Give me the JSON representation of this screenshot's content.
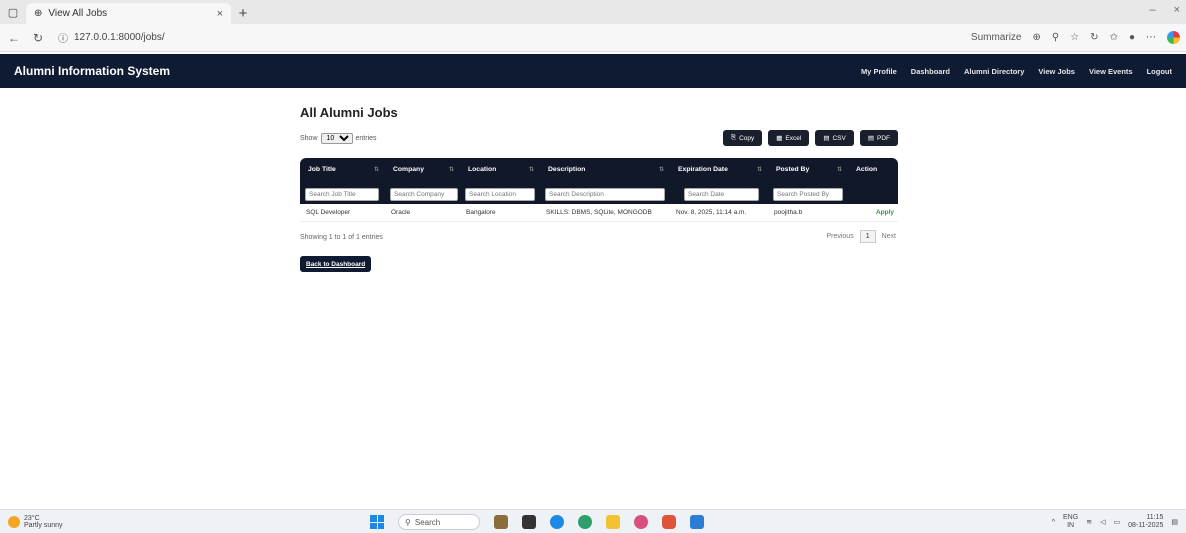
{
  "browser": {
    "tab_title": "View All Jobs",
    "tab_close": "×",
    "new_tab": "+",
    "url": "127.0.0.1:8000/jobs/",
    "summarize_label": "Summarize",
    "win_min": "–",
    "win_close": "×"
  },
  "navbar": {
    "brand": "Alumni Information System",
    "links": [
      "My Profile",
      "Dashboard",
      "Alumni Directory",
      "View Jobs",
      "View Events",
      "Logout"
    ]
  },
  "page": {
    "title": "All Alumni Jobs",
    "show_label": "Show",
    "entries_label": "entries",
    "length_value": "10"
  },
  "export_buttons": [
    "Copy",
    "Excel",
    "CSV",
    "PDF"
  ],
  "table": {
    "headers": [
      "Job Title",
      "Company",
      "Location",
      "Description",
      "Expiration Date",
      "Posted By",
      "Action"
    ],
    "filters": [
      "Search Job Title",
      "Search Company",
      "Search Location",
      "Search Description",
      "Search Date",
      "Search Posted By"
    ],
    "rows": [
      [
        "SQL Developer",
        "Oracle",
        "Bangalore",
        "SKILLS: DBMS, SQLite, MONGODB",
        "Nov. 8, 2025, 11:14 a.m.",
        "poojitha.b",
        "Apply"
      ]
    ],
    "info": "Showing 1 to 1 of 1 entries",
    "prev": "Previous",
    "page": "1",
    "next": "Next"
  },
  "back_button": "Back to Dashboard",
  "taskbar": {
    "temp": "23°C",
    "weather": "Partly sunny",
    "search": "Search",
    "lang": "ENG",
    "region": "IN",
    "time": "11:15",
    "date": "08-11-2025"
  }
}
